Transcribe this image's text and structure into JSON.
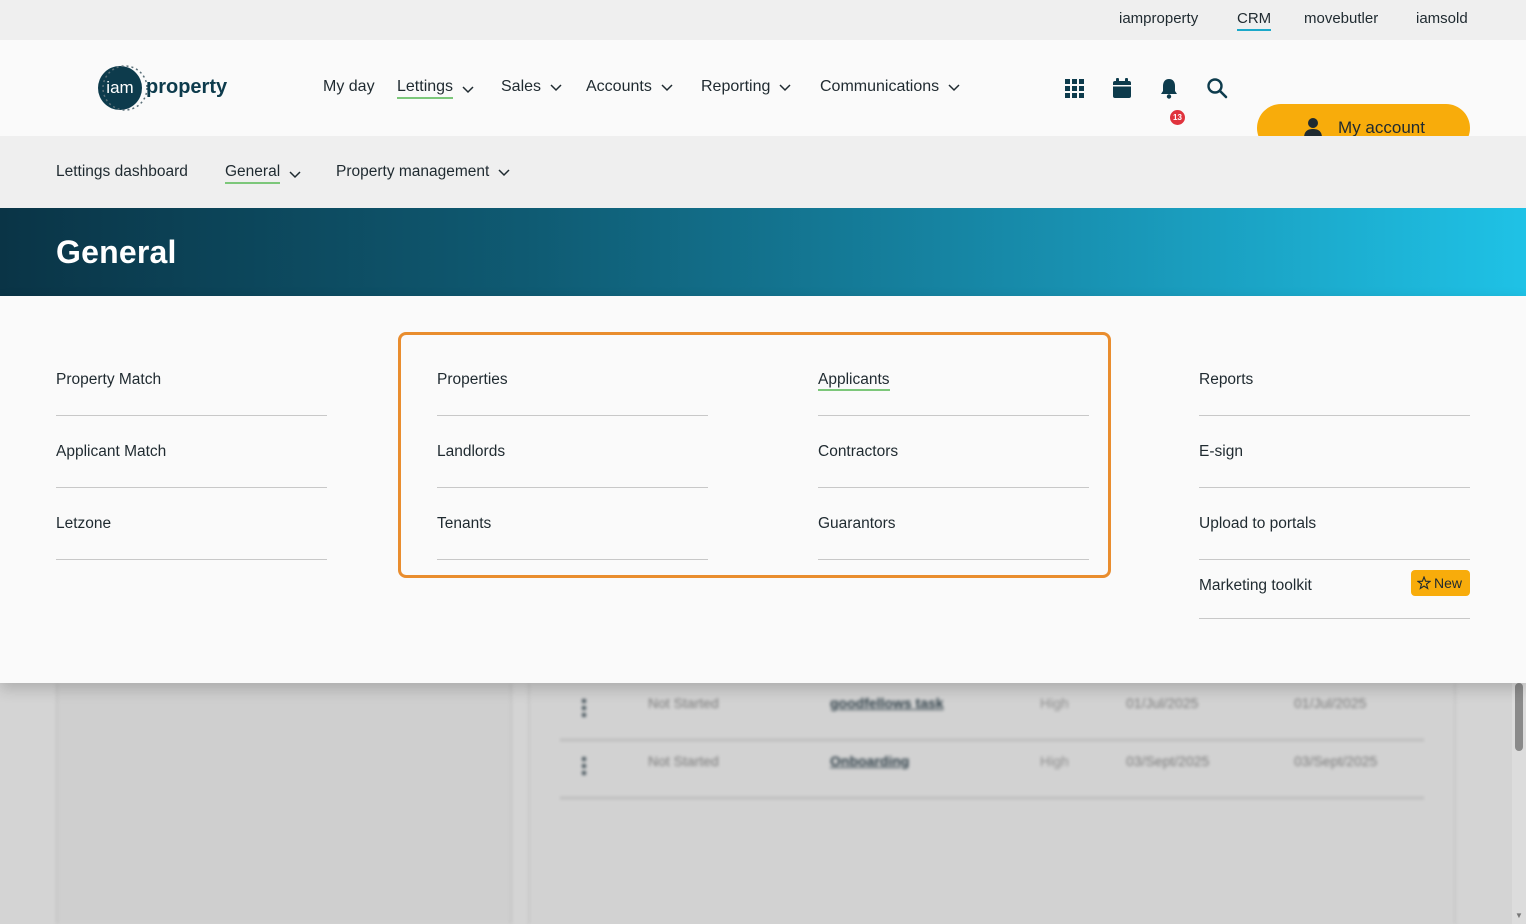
{
  "top_links": [
    {
      "label": "iamproperty",
      "active": false
    },
    {
      "label": "CRM",
      "active": true
    },
    {
      "label": "movebutler",
      "active": false
    },
    {
      "label": "iamsold",
      "active": false
    }
  ],
  "logo": {
    "text_left": "iam",
    "text_right": "property"
  },
  "main_nav": [
    {
      "label": "My day",
      "dropdown": false
    },
    {
      "label": "Lettings",
      "dropdown": true,
      "active": true
    },
    {
      "label": "Sales",
      "dropdown": true
    },
    {
      "label": "Accounts",
      "dropdown": true
    },
    {
      "label": "Reporting",
      "dropdown": true
    },
    {
      "label": "Communications",
      "dropdown": true
    }
  ],
  "header_icons": [
    "apps-grid-icon",
    "calendar-icon",
    "bell-icon",
    "search-icon"
  ],
  "notifications_count": "13",
  "account_button": {
    "label": "My account",
    "icon": "user-icon"
  },
  "sub_nav": [
    {
      "label": "Lettings dashboard",
      "dropdown": false
    },
    {
      "label": "General",
      "dropdown": true,
      "active": true
    },
    {
      "label": "Property management",
      "dropdown": true
    }
  ],
  "banner": {
    "title": "General"
  },
  "menu": {
    "col1": [
      "Property Match",
      "Applicant Match",
      "Letzone"
    ],
    "col2": [
      "Properties",
      "Landlords",
      "Tenants"
    ],
    "col3": [
      "Applicants",
      "Contractors",
      "Guarantors"
    ],
    "col4": [
      "Reports",
      "E-sign",
      "Upload to portals",
      "Marketing toolkit"
    ],
    "active_item": "Applicants",
    "new_badge": "New"
  },
  "background_tasks": [
    {
      "status": "Not Started",
      "task": "goodfellows task",
      "priority": "High",
      "start": "01/Jul/2025",
      "due": "01/Jul/2025"
    },
    {
      "status": "Not Started",
      "task": "Onboarding",
      "priority": "High",
      "start": "03/Sept/2025",
      "due": "03/Sept/2025"
    }
  ],
  "colors": {
    "accent_orange": "#f8ac0b",
    "highlight_border": "#e98d2e",
    "active_underline": "#7cc77a",
    "crm_underline": "#1ba8c9",
    "banner_dark": "#0a3446",
    "banner_light": "#1fc2e6"
  }
}
